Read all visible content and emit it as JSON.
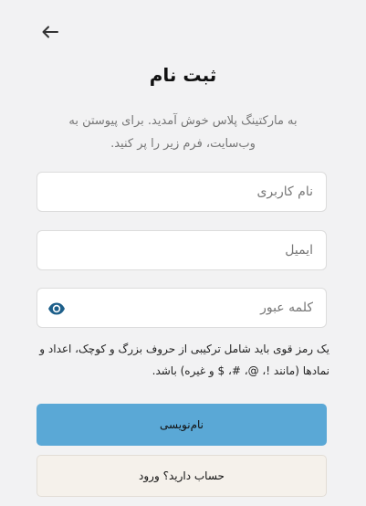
{
  "header": {
    "back_icon": "arrow-left-icon",
    "title": "ثبت نام",
    "subtitle": "به مارکتینگ پلاس خوش آمدید. برای پیوستن به وب‌سایت، فرم زیر را پر کنید."
  },
  "form": {
    "username": {
      "placeholder": "نام کاربری",
      "value": ""
    },
    "email": {
      "placeholder": "ایمیل",
      "value": ""
    },
    "password": {
      "placeholder": "کلمه عبور",
      "value": "",
      "toggle_icon": "eye-icon"
    },
    "password_hint": "یک رمز قوی باید شامل ترکیبی از حروف بزرگ و کوچک، اعداد و نمادها (مانند !، @، #، $ و غیره) باشد."
  },
  "actions": {
    "signup_label": "نام‌نویسی",
    "login_label": "حساب دارید؟ ورود"
  },
  "colors": {
    "primary_button": "#5aa8d6",
    "secondary_button": "#f5f1eb",
    "eye_icon": "#1d5f8a"
  }
}
